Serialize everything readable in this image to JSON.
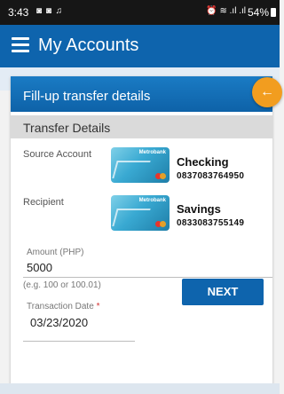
{
  "status_bar": {
    "time": "3:43",
    "notification_icons": "◙ ◙ ♫",
    "system_icons": "⏰ ≋ .ıl .ıl",
    "battery": "54%"
  },
  "app_bar": {
    "title": "My Accounts",
    "menu_icon": "hamburger-menu-icon"
  },
  "card": {
    "title": "Fill-up transfer details",
    "back_icon": "arrow-left-icon",
    "back_glyph": "←"
  },
  "section": {
    "title": "Transfer Details"
  },
  "source": {
    "label": "Source Account",
    "card_brand": "Metrobank",
    "account_type": "Checking",
    "account_number": "0837083764950"
  },
  "recipient": {
    "label": "Recipient",
    "card_brand": "Metrobank",
    "account_type": "Savings",
    "account_number": "0833083755149"
  },
  "amount": {
    "label": "Amount (PHP)",
    "value": "5000",
    "hint": "(e.g. 100 or 100.01)"
  },
  "transaction_date": {
    "label": "Transaction Date",
    "required_mark": "*",
    "value": "03/23/2020"
  },
  "actions": {
    "next_label": "NEXT"
  },
  "colors": {
    "primary": "#0e64ad",
    "accent": "#f29d1f"
  }
}
